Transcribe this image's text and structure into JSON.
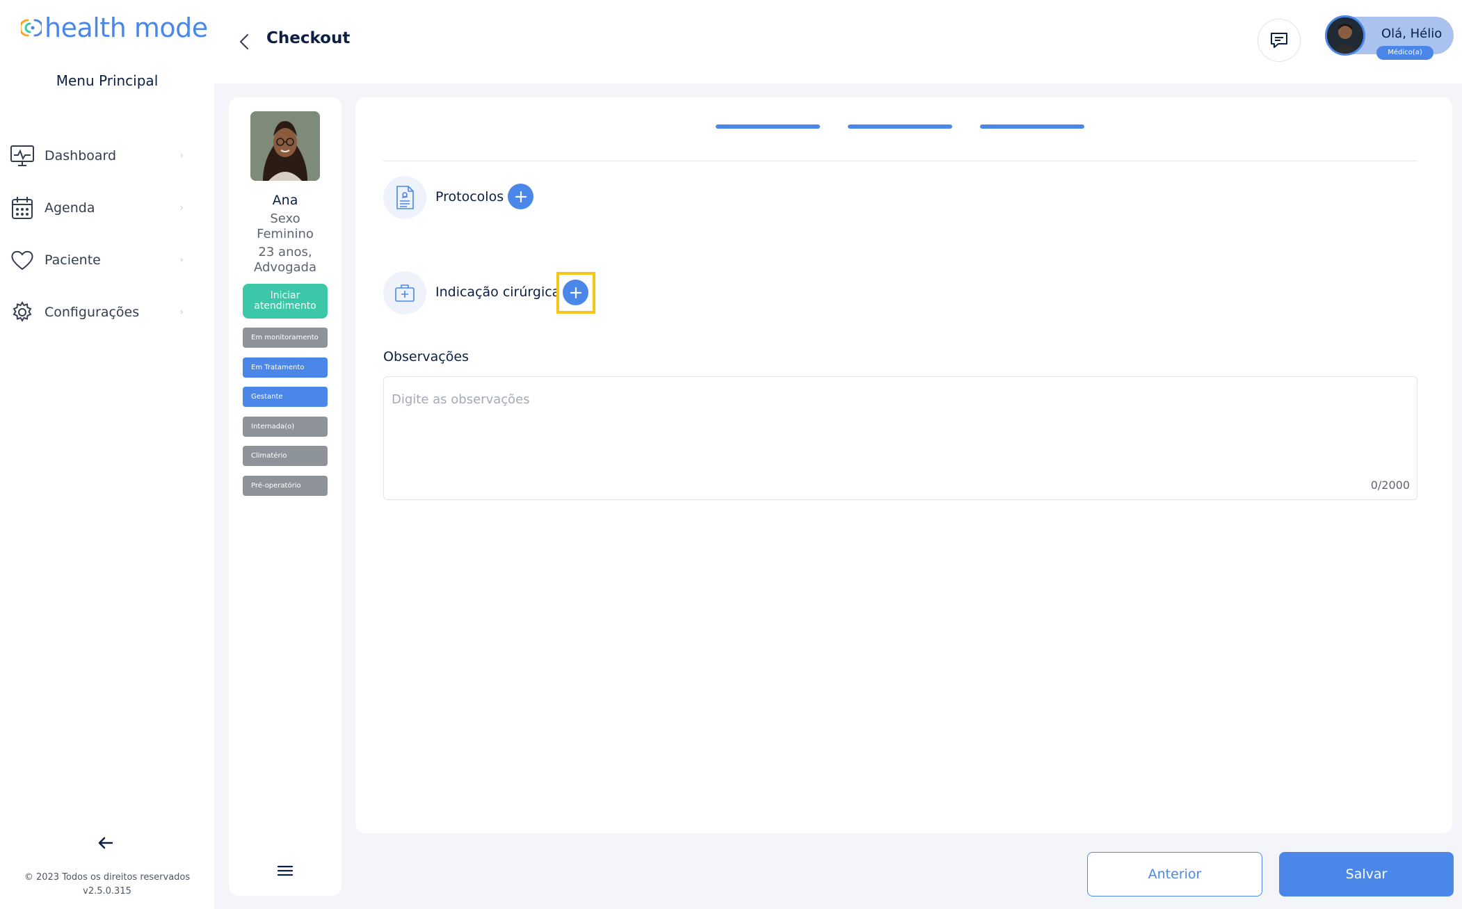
{
  "brand": {
    "name": "health mode",
    "accent": "#4a87e8",
    "teal": "#3cc7a9"
  },
  "sidebar": {
    "menu_title": "Menu Principal",
    "items": [
      {
        "label": "Dashboard",
        "icon": "monitor-icon"
      },
      {
        "label": "Agenda",
        "icon": "calendar-icon"
      },
      {
        "label": "Paciente",
        "icon": "heart-icon"
      },
      {
        "label": "Configurações",
        "icon": "gear-icon"
      }
    ],
    "copyright": "© 2023 Todos os direitos reservados",
    "version": "v2.5.0.315"
  },
  "header": {
    "title": "Checkout",
    "greeting": "Olá, Hélio",
    "role": "Médico(a)"
  },
  "patient": {
    "name": "Ana",
    "sex": "Sexo Feminino",
    "age_profession": "23 anos, Advogada",
    "start_button": "Iniciar atendimento",
    "tags": [
      {
        "label": "Em monitoramento",
        "color": "gray"
      },
      {
        "label": "Em Tratamento",
        "color": "blue"
      },
      {
        "label": "Gestante",
        "color": "blue"
      },
      {
        "label": "Internada(o)",
        "color": "gray"
      },
      {
        "label": "Climatério",
        "color": "gray"
      },
      {
        "label": "Pré-operatório",
        "color": "gray"
      }
    ]
  },
  "checkout": {
    "steps_count": 3,
    "protocols_label": "Protocolos",
    "surgical_label": "Indicação cirúrgica",
    "observations_label": "Observações",
    "observations_placeholder": "Digite as observações",
    "observations_counter": "0/2000"
  },
  "footer": {
    "previous_label": "Anterior",
    "save_label": "Salvar"
  }
}
